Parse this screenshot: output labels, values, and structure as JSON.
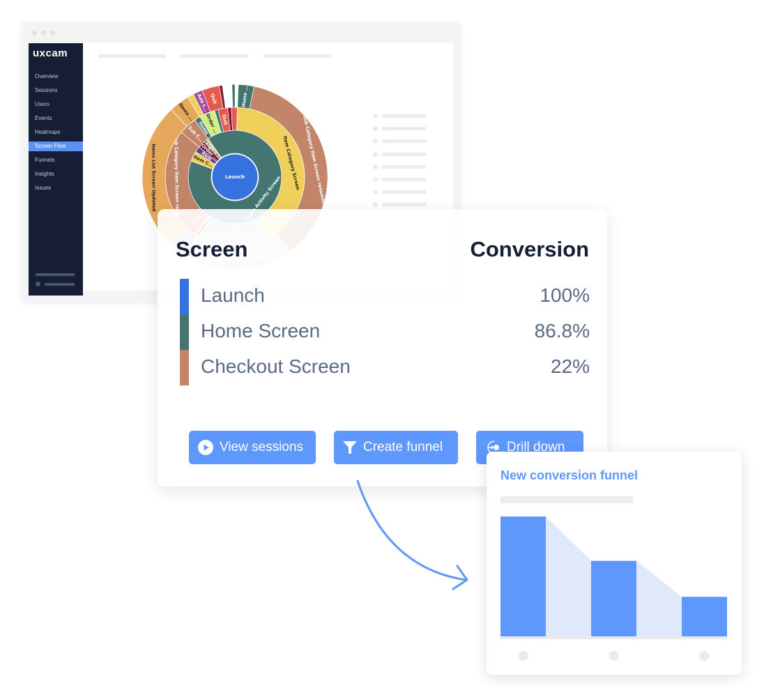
{
  "app": {
    "logo": "uxcam",
    "nav": [
      "Overview",
      "Sessions",
      "Users",
      "Events",
      "Heatmaps",
      "Screen Flow",
      "Funnels",
      "Insights",
      "Issues"
    ],
    "active_nav": "Screen Flow"
  },
  "sunburst": {
    "center": {
      "label": "Launch",
      "color": "#3572e0"
    },
    "rings": [
      [
        {
          "label": "Home Activity Screen",
          "value": 325,
          "color": "#447570"
        },
        {
          "label": "Item C...",
          "value": 13,
          "color": "#f1cf5b"
        },
        {
          "label": "Item",
          "value": 7,
          "color": "#5b3f8e"
        },
        {
          "label": "Order ...",
          "value": 9,
          "color": "#7a1a2c"
        },
        {
          "label": "Sign-I...",
          "value": 4,
          "color": "#5b8080"
        },
        {
          "label": "",
          "value": 2,
          "color": "#f1cf5b"
        }
      ],
      [
        {
          "label": "Item Category Screen",
          "value": 148,
          "color": "#f1cf5b"
        },
        {
          "label": "Item Details Screen",
          "value": 60,
          "color": "#c9c4dc"
        },
        {
          "label": "Popul...",
          "value": 5,
          "color": "#f5e49a"
        },
        {
          "label": "Quit",
          "value": 13,
          "color": "#e7594f"
        },
        {
          "label": "Sub Category Item Screen rena...",
          "value": 82,
          "color": "#c2856a"
        },
        {
          "label": "Sub C...",
          "value": 15,
          "color": "#c2856a"
        },
        {
          "label": "Items",
          "value": 5,
          "color": "#447570"
        },
        {
          "label": "Order ...",
          "value": 13,
          "color": "#d4ee85"
        },
        {
          "label": "",
          "value": 3,
          "color": "#447570"
        },
        {
          "label": "Quit",
          "value": 8,
          "color": "#e7594f"
        },
        {
          "label": "",
          "value": 3,
          "color": "#7a1a2c"
        },
        {
          "label": "",
          "value": 5,
          "color": "#e7594f"
        }
      ],
      [
        {
          "label": "Sub Category Item Screen renamed",
          "value": 133,
          "color": "#c2856a"
        },
        {
          "label": "Home Activity Screen",
          "value": 70,
          "color": "#c6d6d4"
        },
        {
          "label": "",
          "value": 10,
          "color": "#b9b4d6"
        },
        {
          "label": "Items List Screen Updated",
          "value": 95,
          "color": "#e5a85b"
        },
        {
          "label": "Items ...",
          "value": 13,
          "color": "#e5a85b"
        },
        {
          "label": "",
          "value": 4,
          "color": "#f1cf5b"
        },
        {
          "label": "Add t...",
          "value": 6,
          "color": "#a5479b"
        },
        {
          "label": "Quit",
          "value": 11,
          "color": "#e7594f"
        },
        {
          "label": "",
          "value": 2,
          "color": "#7a1a2c"
        },
        {
          "label": "",
          "value": 6,
          "color": "#ffffff"
        },
        {
          "label": "",
          "value": 2,
          "color": "#447570"
        },
        {
          "label": "",
          "value": 2,
          "color": "#ffffff"
        },
        {
          "label": "Home ...",
          "value": 10,
          "color": "#447570"
        }
      ]
    ]
  },
  "card": {
    "col_screen": "Screen",
    "col_conversion": "Conversion",
    "rows": [
      {
        "name": "Launch",
        "value": "100%",
        "color": "#3572e0"
      },
      {
        "name": "Home Screen",
        "value": "86.8%",
        "color": "#447570"
      },
      {
        "name": "Checkout Screen",
        "value": "22%",
        "color": "#c2856a"
      }
    ],
    "buttons": [
      {
        "label": "View sessions",
        "icon": "play-circle-icon"
      },
      {
        "label": "Create funnel",
        "icon": "funnel-icon"
      },
      {
        "label": "Drill down",
        "icon": "drill-down-icon"
      }
    ]
  },
  "funnel": {
    "title": "New conversion funnel",
    "chart_data": {
      "type": "bar",
      "categories": [
        "",
        "",
        ""
      ],
      "values": [
        100,
        63,
        33
      ],
      "bar_color": "#5e98fd",
      "drop_color": "#dfe9fb"
    }
  }
}
